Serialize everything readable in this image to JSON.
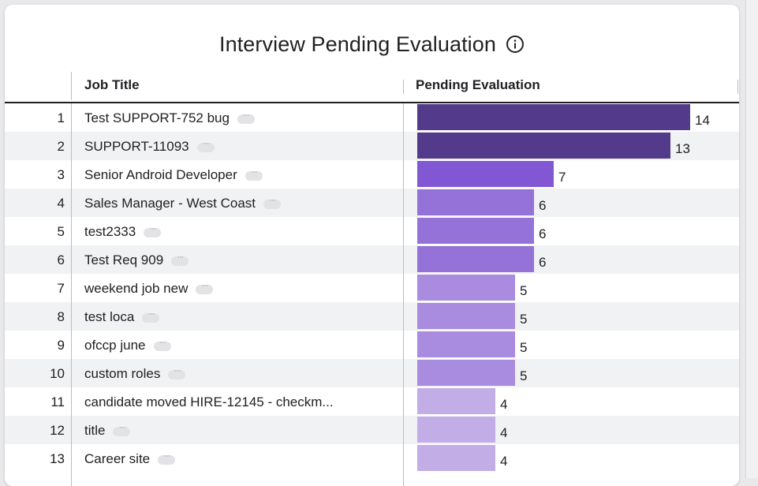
{
  "widget": {
    "title": "Interview Pending Evaluation",
    "info_icon": "info-circle-icon",
    "columns": [
      "Job Title",
      "Pending Evaluation"
    ]
  },
  "colors": {
    "scale": [
      "#c3ade6",
      "#a98bdf",
      "#9572d7",
      "#8257d3",
      "#533a8a"
    ]
  },
  "chart_data": {
    "type": "table",
    "columns": [
      "Job Title",
      "Pending Evaluation"
    ],
    "rows": [
      {
        "index": "1",
        "title": "Test SUPPORT-752 bug",
        "value": 14,
        "more": true
      },
      {
        "index": "2",
        "title": "SUPPORT-11093",
        "value": 13,
        "more": true
      },
      {
        "index": "3",
        "title": "Senior Android Developer",
        "value": 7,
        "more": true
      },
      {
        "index": "4",
        "title": "Sales Manager - West Coast",
        "value": 6,
        "more": true
      },
      {
        "index": "5",
        "title": "test2333",
        "value": 6,
        "more": true
      },
      {
        "index": "6",
        "title": "Test Req 909",
        "value": 6,
        "more": true
      },
      {
        "index": "7",
        "title": "weekend job new",
        "value": 5,
        "more": true
      },
      {
        "index": "8",
        "title": "test loca",
        "value": 5,
        "more": true
      },
      {
        "index": "9",
        "title": "ofccp june",
        "value": 5,
        "more": true
      },
      {
        "index": "10",
        "title": "custom roles",
        "value": 5,
        "more": true
      },
      {
        "index": "11",
        "title": "candidate moved HIRE-12145 - checkm...",
        "value": 4,
        "more": false
      },
      {
        "index": "12",
        "title": "title",
        "value": 4,
        "more": true
      },
      {
        "index": "13",
        "title": "Career site",
        "value": 4,
        "more": true
      }
    ],
    "xlim": [
      0,
      14
    ]
  }
}
